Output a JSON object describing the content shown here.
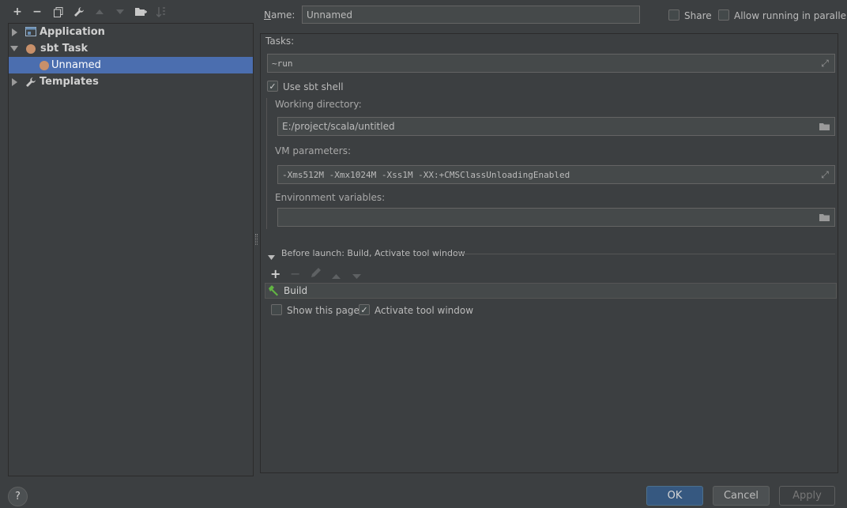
{
  "toolbar": {
    "add": "+",
    "remove": "−",
    "copy": "⧉",
    "edit": "🔧",
    "up": "▲",
    "down": "▼",
    "folder": "📁",
    "sort": "↓"
  },
  "tree": {
    "items": [
      {
        "label": "Application"
      },
      {
        "label": "sbt Task"
      },
      {
        "label": "Unnamed"
      },
      {
        "label": "Templates"
      }
    ]
  },
  "name": {
    "label": "Name:",
    "value": "Unnamed"
  },
  "share": {
    "label": "Share"
  },
  "parallel": {
    "label": "Allow running in parallel"
  },
  "tasks": {
    "label": "Tasks:",
    "value": "~run"
  },
  "use_sbt_shell": {
    "label": "Use sbt shell"
  },
  "working_dir": {
    "label": "Working directory:",
    "value": "E:/project/scala/untitled"
  },
  "vm_params": {
    "label": "VM parameters:",
    "value": "-Xms512M -Xmx1024M -Xss1M -XX:+CMSClassUnloadingEnabled"
  },
  "env_vars": {
    "label": "Environment variables:",
    "value": ""
  },
  "before_launch": {
    "title": "Before launch: Build, Activate tool window",
    "items": [
      {
        "label": "Build"
      }
    ]
  },
  "show_page": {
    "label": "Show this page"
  },
  "activate_tool": {
    "label": "Activate tool window"
  },
  "buttons": {
    "ok": "OK",
    "cancel": "Cancel",
    "apply": "Apply",
    "help": "?"
  },
  "colors": {
    "accent": "#4b6eaf",
    "primary_button": "#365880",
    "background": "#3c3f41"
  }
}
